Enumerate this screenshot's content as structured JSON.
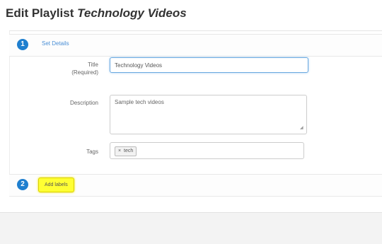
{
  "page": {
    "title_prefix": "Edit Playlist",
    "title_name": "Technology Videos"
  },
  "steps": [
    {
      "number": "1",
      "label": "Set Details"
    },
    {
      "number": "2",
      "label": "Add labels"
    }
  ],
  "form": {
    "title_label": "Title",
    "title_required": "(Required)",
    "title_value": "Technology Videos",
    "description_label": "Description",
    "description_value": "Sample tech videos",
    "tags_label": "Tags",
    "tag_remove_symbol": "×",
    "tags": [
      "tech"
    ]
  },
  "colors": {
    "accent": "#1f7fcf",
    "highlight": "#ffff33"
  }
}
